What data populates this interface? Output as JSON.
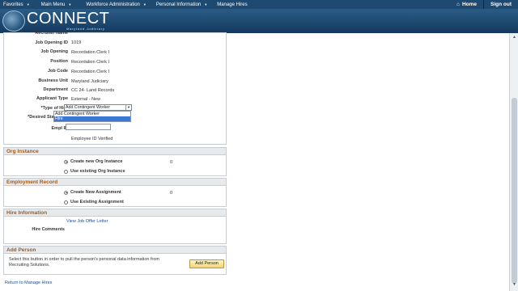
{
  "nav": {
    "items": [
      "Favorites",
      "Main Menu",
      "Workforce Administration",
      "Personal Information",
      "Manage Hires"
    ],
    "home": "Home",
    "signout": "Sign out"
  },
  "brand": {
    "name": "CONNECT",
    "subtitle": "Maryland Judiciary"
  },
  "details": {
    "recruiter_label": "Recruiter Name",
    "fields": [
      {
        "label": "Job Opening ID",
        "value": "1019"
      },
      {
        "label": "Job Opening",
        "value": "Recordation Clerk I"
      },
      {
        "label": "Position",
        "value": "Recordation Clerk I"
      },
      {
        "label": "Job Code",
        "value": "Recordation Clerk I"
      },
      {
        "label": "Business Unit",
        "value": "Maryland Judiciary"
      },
      {
        "label": "Department",
        "value": "CC 24- Land Records"
      },
      {
        "label": "Applicant Type",
        "value": "External - New"
      }
    ],
    "type_of_hire_label": "*Type of Hire",
    "type_of_hire_value": "Add Contingent Worker",
    "type_of_hire_options": [
      "Add Contingent Worker",
      "Hire"
    ],
    "type_of_hire_highlighted": "Hire",
    "desired_start_label": "*Desired Start Date",
    "empl_id_label": "Empl ID",
    "empl_status": "Employee ID Verified"
  },
  "org_instance": {
    "title": "Org Instance",
    "create_label": "Create new Org Instance",
    "use_label": "Use existing Org Instance",
    "count": "0"
  },
  "employment_record": {
    "title": "Employment Record",
    "create_label": "Create New Assignment",
    "use_label": "Use Existing Assignment",
    "count": "0"
  },
  "hire_information": {
    "title": "Hire Information",
    "offer_link": "View Job Offer Letter",
    "comments_label": "Hire Comments"
  },
  "add_person": {
    "title": "Add Person",
    "description": "Select this button in order to pull the person's personal data information from Recruiting Solutions.",
    "button": "Add Person"
  },
  "footer": {
    "return_link": "Return to Manage Hires"
  },
  "colors": {
    "nav_bg": "#1e4a72",
    "section_title": "#a55a1a",
    "link": "#1f4e8c",
    "highlight": "#3b78d6"
  }
}
